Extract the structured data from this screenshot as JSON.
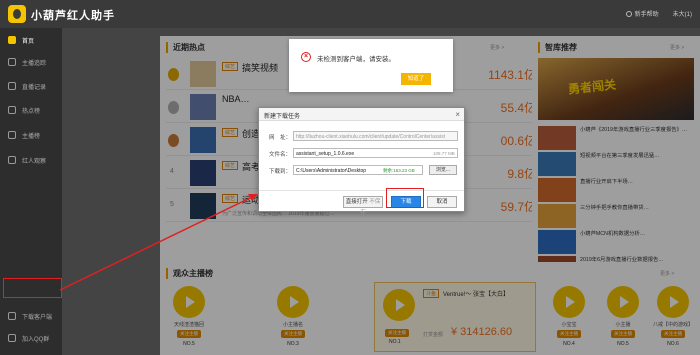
{
  "app": {
    "title": "小葫芦红人助手",
    "top_actions": [
      "新手帮助",
      "未大(1)"
    ]
  },
  "sidebar": {
    "items": [
      {
        "label": "首页",
        "active": true
      },
      {
        "label": "主播追踪"
      },
      {
        "label": "直播记录"
      },
      {
        "label": "热点榜"
      },
      {
        "label": "主播榜"
      },
      {
        "label": "红人观察"
      }
    ],
    "bottom_items": [
      {
        "label": "下载客户端"
      },
      {
        "label": "加入QQ群"
      }
    ]
  },
  "hot": {
    "title": "近期热点",
    "more": "更多 >",
    "rows": [
      {
        "tag": "综艺",
        "name": "搞笑视频",
        "value": "1143.1亿",
        "desc": "",
        "rank": ""
      },
      {
        "tag": "",
        "name": "NBA…",
        "value": "55.4亿",
        "desc": "",
        "rank": ""
      },
      {
        "tag": "综艺",
        "name": "创造营",
        "value": "00.6亿",
        "desc": "",
        "rank": ""
      },
      {
        "tag": "综艺",
        "name": "高考加油",
        "value": "9.8亿",
        "desc": "",
        "rank": "4"
      },
      {
        "tag": "综艺",
        "name": "运动亮疆计划",
        "value": "59.7亿",
        "desc": "为广泛宣传和调动全体国民… 2019年播放量超过…",
        "rank": "5"
      }
    ]
  },
  "wisdom": {
    "title": "智库推荐",
    "more": "更多 >",
    "banner": "勇者闯关",
    "items": [
      "小葫芦《2019年游戏直播行业三季度报告》…",
      "短视频平台在第三季度发展迅猛…",
      "直播行业开启下半场…",
      "三分钟手把手教你直播带货…",
      "小葫芦MCN机构数据分析…",
      "2019年6月游戏直播行业数据报告…"
    ]
  },
  "anchors": {
    "title": "观众主播榜",
    "more": "更多 >",
    "list": [
      {
        "name": "天线渣渣猫回",
        "no": "NO.5"
      },
      {
        "name": "小主播名",
        "no": "NO.3"
      },
      {
        "name": "小宝宝",
        "no": "NO.4"
      },
      {
        "name": "小主播",
        "no": "NO.5"
      },
      {
        "name": "八戒【中的游戏】",
        "no": "NO.6"
      }
    ],
    "featured": {
      "tag": "斗鱼",
      "name": "Ventrue!～ 张宝【大白】",
      "no": "NO.1",
      "label": "打赏金额",
      "amount": "¥ 314126.60"
    },
    "follow_label": "关注主播"
  },
  "alert": {
    "message": "未检测到客户端，请安装。",
    "button": "知道了"
  },
  "download_dialog": {
    "title": "新建下载任务",
    "url_label": "网　址：",
    "url": "http://liuzhou-client.xiaohulu.com/client/update/ControlCenter/assist",
    "filename_label": "文件名：",
    "filename": "assistant_setup_1.0.6.exe",
    "file_size": "108.77 MB",
    "path_label": "下载到：",
    "path": "C:\\Users\\Administrator\\Desktop",
    "free_space": "剩余:163.23 GB",
    "browse": "浏览...",
    "open_btn": "直接打开",
    "open_sub": "不保存",
    "download_btn": "下载",
    "cancel_btn": "取消"
  }
}
